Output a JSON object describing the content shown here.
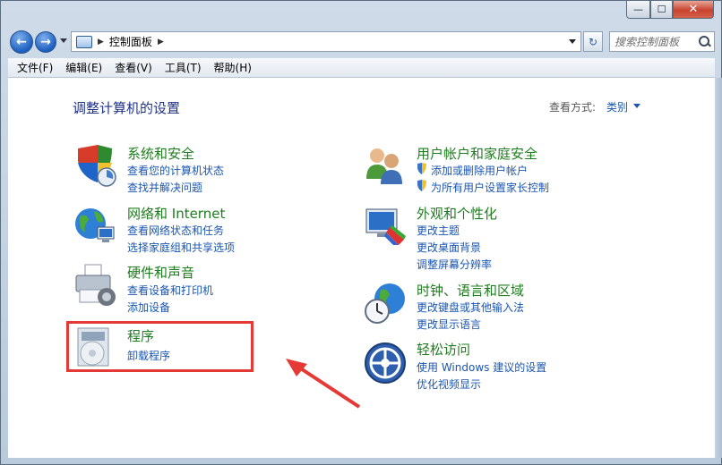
{
  "window": {
    "controls": {
      "minimize": "—",
      "maximize": "☐",
      "close": "✕"
    }
  },
  "nav": {
    "back_glyph": "←",
    "forward_glyph": "→",
    "address_sep": "▶",
    "address_path": "控制面板",
    "address_sep_end": "▶",
    "refresh_glyph": "↻",
    "search_placeholder": "搜索控制面板"
  },
  "menu": [
    "文件(F)",
    "编辑(E)",
    "查看(V)",
    "工具(T)",
    "帮助(H)"
  ],
  "main": {
    "title": "调整计算机的设置",
    "view_by_label": "查看方式:",
    "view_by_value": "类别"
  },
  "categories": [
    {
      "title": "系统和安全",
      "links": [
        "查看您的计算机状态",
        "查找并解决问题"
      ],
      "icon": "shield-check-icon"
    },
    {
      "title": "网络和 Internet",
      "links": [
        "查看网络状态和任务",
        "选择家庭组和共享选项"
      ],
      "icon": "network-globe-icon"
    },
    {
      "title": "硬件和声音",
      "links": [
        "查看设备和打印机",
        "添加设备"
      ],
      "icon": "printer-icon"
    },
    {
      "title": "程序",
      "links": [
        "卸载程序"
      ],
      "icon": "programs-disc-icon"
    },
    {
      "title": "用户帐户和家庭安全",
      "links": [
        "添加或删除用户帐户",
        "为所有用户设置家长控制"
      ],
      "icon": "users-icon"
    },
    {
      "title": "外观和个性化",
      "links": [
        "更改主题",
        "更改桌面背景",
        "调整屏幕分辨率"
      ],
      "icon": "monitor-palette-icon"
    },
    {
      "title": "时钟、语言和区域",
      "links": [
        "更改键盘或其他输入法",
        "更改显示语言"
      ],
      "icon": "clock-globe-icon"
    },
    {
      "title": "轻松访问",
      "links": [
        "使用 Windows 建议的设置",
        "优化视频显示"
      ],
      "icon": "ease-of-access-icon"
    }
  ],
  "colors": {
    "category_title": "#1e7d1e",
    "link": "#1a55b0",
    "page_title": "#1e3287",
    "highlight": "#e53935"
  }
}
